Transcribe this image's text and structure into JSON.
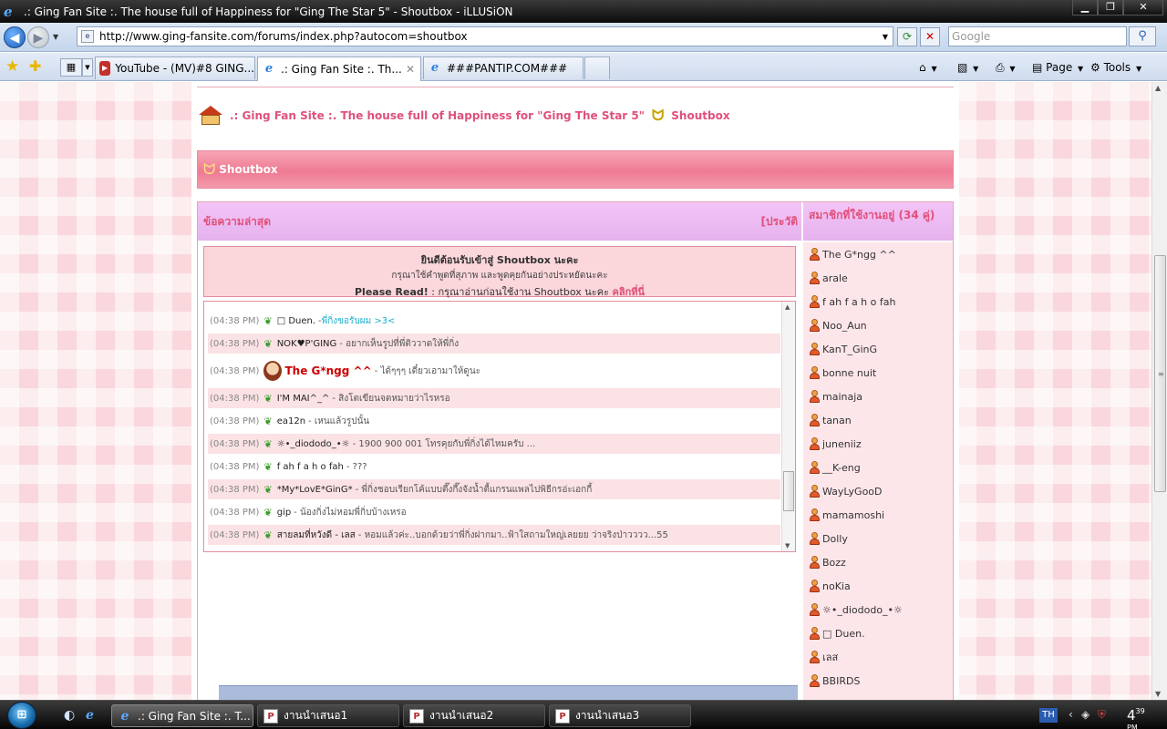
{
  "window": {
    "title": ".: Ging Fan Site :. The house full of Happiness for \"Ging The Star 5\" - Shoutbox - iLLUSiON",
    "minimize": "▁",
    "maximize": "❐",
    "close": "✕"
  },
  "address": {
    "url": "http://www.ging-fansite.com/forums/index.php?autocom=shoutbox",
    "search_placeholder": "Google"
  },
  "tabs": [
    {
      "label": "YouTube - (MV)#8 GING...",
      "icon": "youtube-icon"
    },
    {
      "label": ".: Ging Fan Site :. Th...",
      "icon": "ie-page-icon",
      "active": true
    },
    {
      "label": "###PANTIP.COM###",
      "icon": "ie-page-icon"
    }
  ],
  "commands": {
    "page": "Page",
    "tools": "Tools"
  },
  "page": {
    "breadcrumb_site": ".: Ging Fan Site :. The house full of Happiness for \"Ging The Star 5\"",
    "breadcrumb_current": "Shoutbox",
    "section_title": "Shoutbox",
    "latest_header": "ข้อความล่าสุด",
    "history_link": "[ประวัติ",
    "members_header": "สมาชิกที่ใช้งานอยู่ (34 คู่)",
    "welcome_line1": "ยินดีต้อนรับเข้าสู่ Shoutbox นะคะ",
    "welcome_line2": "กรุณาใช้คำพูดที่สุภาพ และพูดคุยกันอย่างประหยัดนะคะ",
    "welcome_read": "Please Read!",
    "welcome_line3": " : กรุณาอ่านก่อนใช้งาน Shoutbox นะคะ ",
    "welcome_link": "คลิกที่นี่"
  },
  "messages": [
    {
      "time": "(04:38 PM)",
      "user": "□ Duen.",
      "text": "- ",
      "cyan": "พี่กิ่งขอรับผม >3<"
    },
    {
      "time": "(04:38 PM)",
      "user": "NOK♥P'GING",
      "text": "- อยากเห็นรูปที่พี่ติววาดให้พี่กิ่ง"
    },
    {
      "time": "(04:38 PM)",
      "user": "The G*ngg ^^",
      "text": "- ได้ๆๆๆ เดี๋ยวเอามาให้ดูนะ"
    },
    {
      "time": "(04:38 PM)",
      "user": "I'M MAI^_^",
      "text": "- สิงโตเขียนจดหมายว่าไรหรอ"
    },
    {
      "time": "(04:38 PM)",
      "user": "ea12n",
      "text": "- เหนแล้วรูปนั้น"
    },
    {
      "time": "(04:38 PM)",
      "user": "☼•_diododo_•☼",
      "text": "- 1900 900 001 โทรคุยกับพี่กิ่งได้ไหมครับ ..."
    },
    {
      "time": "(04:38 PM)",
      "user": "f ah f a h o fah",
      "text": "- ???"
    },
    {
      "time": "(04:38 PM)",
      "user": "*My*LovE*GinG*",
      "text": "- พี่กิ่งชอบเรียกโค้แบบตึ๊งกึ๊งจังน้ำตื้แกรนแพลไปพิธีกรอ่ะเอกกี้"
    },
    {
      "time": "(04:38 PM)",
      "user": "gip",
      "text": "- น้องกิ่งไม่หอมพี่กิ่บบ้างเหรอ"
    },
    {
      "time": "(04:38 PM)",
      "user": "สายลมที่หวังดี - เลส",
      "text": "- หอมแล้วค่ะ..บอกด้วยว่าพี่กิ่งฝากมา..ฟ้าใสถามใหญ่เลยยย ว่าจริงป่าวววว...55"
    }
  ],
  "members": [
    "The G*ngg ^^",
    "arale",
    "f ah f a h o fah",
    "Noo_Aun",
    "KanT_GinG",
    "bonne nuit",
    "mainaja",
    "tanan",
    "juneniiz",
    "__K-eng",
    "WayLyGooD",
    "mamamoshi",
    "Dolly",
    "Bozz",
    "noKia",
    "☼•_diododo_•☼",
    "□ Duen.",
    "เลส",
    "BBIRDS"
  ],
  "taskbar": {
    "items": [
      {
        "label": ".: Ging Fan Site :. T...",
        "icon": "ie-icon",
        "active": true
      },
      {
        "label": "งานนำเสนอ1",
        "icon": "powerpoint-icon"
      },
      {
        "label": "งานนำเสนอ2",
        "icon": "powerpoint-icon"
      },
      {
        "label": "งานนำเสนอ3",
        "icon": "powerpoint-icon"
      }
    ],
    "lang": "TH",
    "clock_hour": "4",
    "clock_min": "39",
    "clock_ampm": "PM"
  },
  "colors": {
    "accent_pink": "#e0507a",
    "section_pink": "#ee7a93",
    "header_lilac": "#e6b2ee",
    "cyan_text": "#18b0cf"
  }
}
